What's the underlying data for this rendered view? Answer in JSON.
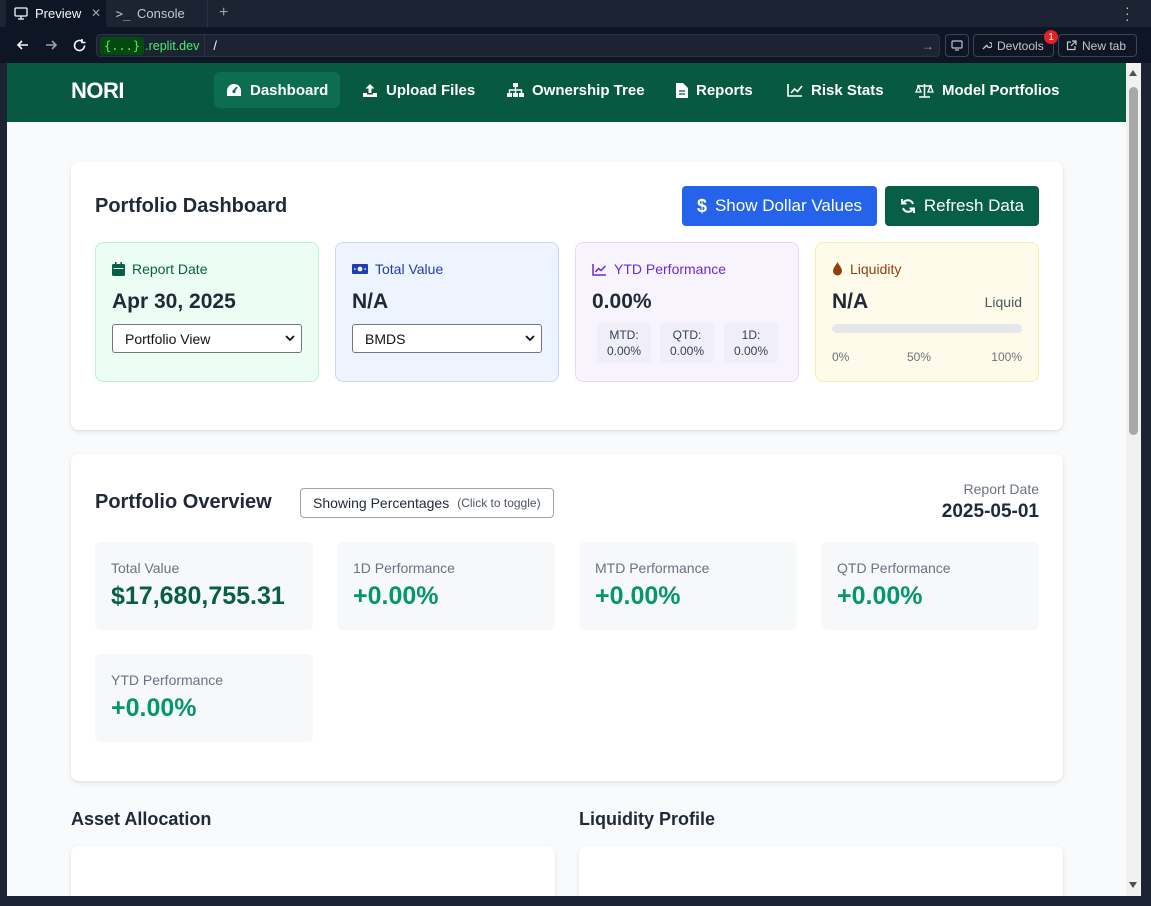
{
  "browser": {
    "tabs": [
      {
        "label": "Preview",
        "active": true
      },
      {
        "label": "Console",
        "active": false
      }
    ],
    "url": {
      "domain_badge": "{...}",
      "domain": ".replit.dev",
      "path": "/"
    },
    "devtools_label": "Devtools",
    "devtools_badge": "1",
    "newtab_label": "New tab"
  },
  "app": {
    "logo": "NORI",
    "nav": [
      {
        "label": "Dashboard",
        "icon": "gauge-icon",
        "active": true
      },
      {
        "label": "Upload Files",
        "icon": "upload-icon"
      },
      {
        "label": "Ownership Tree",
        "icon": "sitemap-icon"
      },
      {
        "label": "Reports",
        "icon": "file-icon"
      },
      {
        "label": "Risk Stats",
        "icon": "chart-line-icon"
      },
      {
        "label": "Model Portfolios",
        "icon": "scale-icon"
      }
    ]
  },
  "dashboard": {
    "title": "Portfolio Dashboard",
    "show_dollar_button": "Show Dollar Values",
    "refresh_button": "Refresh Data",
    "report_date": {
      "label": "Report Date",
      "value": "Apr 30, 2025",
      "select": "Portfolio View"
    },
    "total_value": {
      "label": "Total Value",
      "value": "N/A",
      "select": "BMDS"
    },
    "ytd": {
      "label": "YTD Performance",
      "value": "0.00%",
      "mtd_label": "MTD:",
      "mtd_value": "0.00%",
      "qtd_label": "QTD:",
      "qtd_value": "0.00%",
      "d1_label": "1D:",
      "d1_value": "0.00%"
    },
    "liquidity": {
      "label": "Liquidity",
      "value": "N/A",
      "right_label": "Liquid",
      "fill_fraction": 0,
      "ticks": [
        "0%",
        "50%",
        "100%"
      ]
    }
  },
  "overview": {
    "title": "Portfolio Overview",
    "toggle_label": "Showing Percentages",
    "toggle_hint": "(Click to toggle)",
    "report_date_label": "Report Date",
    "report_date_value": "2025-05-01",
    "metrics": [
      {
        "label": "Total Value",
        "value": "$17,680,755.31"
      },
      {
        "label": "1D Performance",
        "value": "+0.00%"
      },
      {
        "label": "MTD Performance",
        "value": "+0.00%"
      },
      {
        "label": "QTD Performance",
        "value": "+0.00%"
      },
      {
        "label": "YTD Performance",
        "value": "+0.00%"
      }
    ]
  },
  "sections": {
    "asset_allocation": "Asset Allocation",
    "liquidity_profile": "Liquidity Profile"
  },
  "colors": {
    "nav_bg": "#075a3f",
    "primary_blue": "#2563eb",
    "primary_green": "#065f46",
    "positive": "#059669"
  }
}
